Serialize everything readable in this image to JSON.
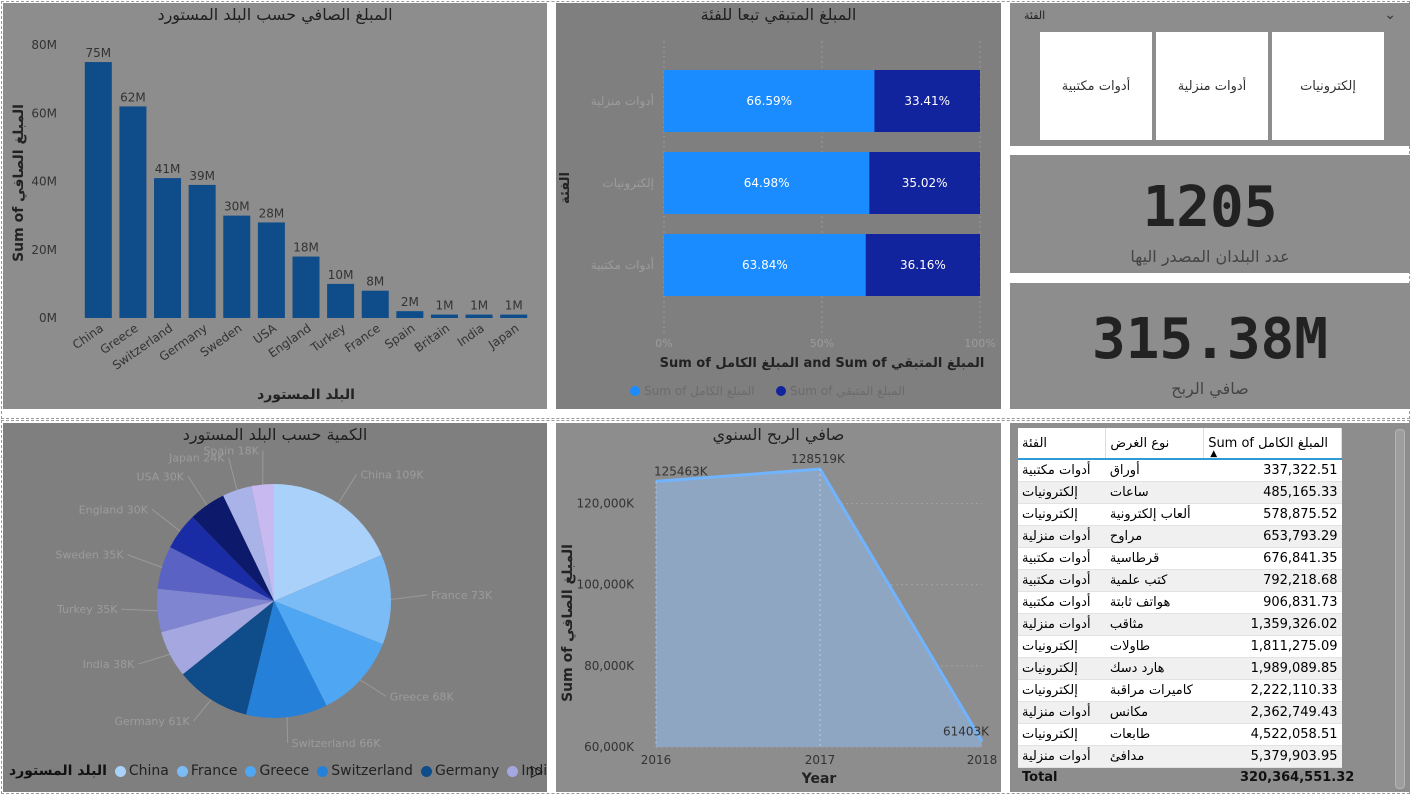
{
  "colors": {
    "dark_blue": "#0f4c8a",
    "bright_blue": "#1a8cff",
    "navy": "#12239e",
    "panel_gray": "#8d8d8d"
  },
  "bar_panel": {
    "title": "المبلغ الصافي حسب البلد المستورد",
    "xlabel": "البلد المستورد",
    "ylabel": "Sum of المبلغ الصافي",
    "chart_data": {
      "type": "bar",
      "categories": [
        "China",
        "Greece",
        "Switzerland",
        "Germany",
        "Sweden",
        "USA",
        "England",
        "Turkey",
        "France",
        "Spain",
        "Britain",
        "India",
        "Japan"
      ],
      "values": [
        75,
        62,
        41,
        39,
        30,
        28,
        18,
        10,
        8,
        2,
        1,
        1,
        1
      ],
      "data_labels": [
        "75M",
        "62M",
        "41M",
        "39M",
        "30M",
        "28M",
        "18M",
        "10M",
        "8M",
        "2M",
        "1M",
        "1M",
        "1M"
      ],
      "yticks": [
        "0M",
        "20M",
        "40M",
        "60M",
        "80M"
      ],
      "ylim": [
        0,
        80
      ]
    }
  },
  "stacked_panel": {
    "title": "المبلغ المتبقي تبعا للفئة",
    "ylabel": "الفئة",
    "xlabel": "Sum of المبلغ الكامل and Sum of المبلغ المتبقي",
    "chart_data": {
      "type": "bar",
      "categories": [
        "أدوات منزلية",
        "إلكترونيات",
        "أدوات مكتبية"
      ],
      "series": [
        {
          "name": "Sum of المبلغ الكامل",
          "values": [
            66.59,
            64.98,
            63.84
          ],
          "labels": [
            "66.59%",
            "64.98%",
            "63.84%"
          ]
        },
        {
          "name": "Sum of المبلغ المتبقي",
          "values": [
            33.41,
            35.02,
            36.16
          ],
          "labels": [
            "33.41%",
            "35.02%",
            "36.16%"
          ]
        }
      ],
      "xticks": [
        "0%",
        "50%",
        "100%"
      ]
    }
  },
  "slicer": {
    "title": "الفئة",
    "options": [
      "إلكترونيات",
      "أدوات منزلية",
      "أدوات مكتبية"
    ],
    "chevron": "chevron-down-icon"
  },
  "kpi1": {
    "value": "1205",
    "label": "عدد البلدان المصدر اليها"
  },
  "kpi2": {
    "value": "315.38M",
    "label": "صافي الربح"
  },
  "pie_panel": {
    "title": "الكمية حسب البلد المستورد",
    "legend_title": "البلد المستورد",
    "legend_items": [
      "China",
      "France",
      "Greece",
      "Switzerland",
      "Germany",
      "India"
    ],
    "chart_data": {
      "type": "pie",
      "labels": [
        "China",
        "France",
        "Greece",
        "Switzerland",
        "Germany",
        "India",
        "Turkey",
        "Sweden",
        "England",
        "USA",
        "Japan",
        "Spain"
      ],
      "values": [
        109,
        73,
        68,
        66,
        61,
        38,
        35,
        35,
        30,
        30,
        24,
        18
      ],
      "data_labels": [
        "China 109K",
        "France 73K",
        "Greece 68K",
        "Switzerland 66K",
        "Germany 61K",
        "India 38K",
        "Turkey 35K",
        "Sweden 35K",
        "England 30K",
        "USA 30K",
        "Japan 24K",
        "Spain 18K"
      ],
      "colors": [
        "#a9d1fa",
        "#7bbcf7",
        "#4fa6f2",
        "#2580da",
        "#0f4c8a",
        "#a5a8e0",
        "#7f85d0",
        "#5a62c4",
        "#1a2ca5",
        "#0d1a6b",
        "#a9b3e8",
        "#c8baf0",
        "#b59ce0"
      ]
    }
  },
  "area_panel": {
    "title": "صافي الربح السنوي",
    "xlabel": "Year",
    "ylabel": "Sum of المبلغ الصافي",
    "chart_data": {
      "type": "area",
      "x": [
        "2016",
        "2017",
        "2018"
      ],
      "y": [
        125463,
        128519,
        61403
      ],
      "data_labels": [
        "125463K",
        "128519K",
        "61403K"
      ],
      "yticks": [
        "60,000K",
        "80,000K",
        "100,000K",
        "120,000K"
      ],
      "ylim": [
        60000,
        130000
      ]
    }
  },
  "table_panel": {
    "columns": [
      "الفئة",
      "نوع الغرض",
      "Sum of المبلغ الكامل"
    ],
    "rows": [
      [
        "أدوات مكتبية",
        "أوراق",
        "337,322.51"
      ],
      [
        "إلكترونيات",
        "ساعات",
        "485,165.33"
      ],
      [
        "إلكترونيات",
        "ألعاب إلكترونية",
        "578,875.52"
      ],
      [
        "أدوات منزلية",
        "مراوح",
        "653,793.29"
      ],
      [
        "أدوات مكتبية",
        "قرطاسية",
        "676,841.35"
      ],
      [
        "أدوات مكتبية",
        "كتب علمية",
        "792,218.68"
      ],
      [
        "أدوات مكتبية",
        "هواتف ثابتة",
        "906,831.73"
      ],
      [
        "أدوات منزلية",
        "مثاقب",
        "1,359,326.02"
      ],
      [
        "إلكترونيات",
        "طاولات",
        "1,811,275.09"
      ],
      [
        "إلكترونيات",
        "هارد دسك",
        "1,989,089.85"
      ],
      [
        "إلكترونيات",
        "كاميرات مراقبة",
        "2,222,110.33"
      ],
      [
        "أدوات منزلية",
        "مكانس",
        "2,362,749.43"
      ],
      [
        "إلكترونيات",
        "طابعات",
        "4,522,058.51"
      ],
      [
        "أدوات منزلية",
        "مدافئ",
        "5,379,903.95"
      ]
    ],
    "total_label": "Total",
    "total_value": "320,364,551.32"
  }
}
